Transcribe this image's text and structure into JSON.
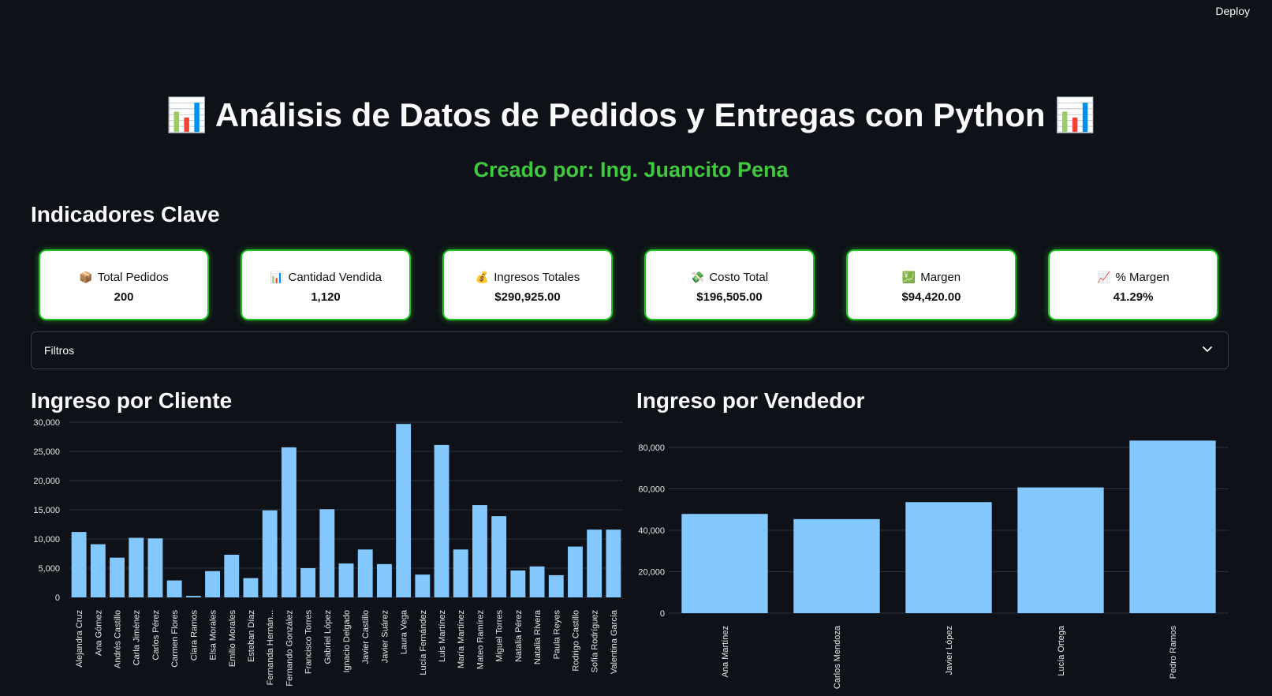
{
  "header": {
    "deploy_label": "Deploy"
  },
  "page": {
    "title": "📊 Análisis de Datos de Pedidos y Entregas con Python 📊",
    "subtitle": "Creado por: Ing. Juancito Pena",
    "kpi_section_title": "Indicadores Clave"
  },
  "kpis": [
    {
      "icon": "📦",
      "icon_name": "package-icon",
      "label": "Total Pedidos",
      "value": "200"
    },
    {
      "icon": "📊",
      "icon_name": "bar-chart-icon",
      "label": "Cantidad Vendida",
      "value": "1,120"
    },
    {
      "icon": "💰",
      "icon_name": "money-bag-icon",
      "label": "Ingresos Totales",
      "value": "$290,925.00"
    },
    {
      "icon": "💸",
      "icon_name": "money-wings-icon",
      "label": "Costo Total",
      "value": "$196,505.00"
    },
    {
      "icon": "💹",
      "icon_name": "chart-yen-icon",
      "label": "Margen",
      "value": "$94,420.00"
    },
    {
      "icon": "📈",
      "icon_name": "trend-up-icon",
      "label": "% Margen",
      "value": "41.29%"
    }
  ],
  "filters": {
    "label": "Filtros",
    "expanded": false
  },
  "colors": {
    "bar": "#83c9ff",
    "accent_green": "#3fc93f",
    "card_border": "#22c322",
    "background": "#0e1117",
    "grid": "#2b2f3a"
  },
  "chart_data": [
    {
      "type": "bar",
      "title": "Ingreso por Cliente",
      "categories": [
        "Alejandra Cruz",
        "Ana Gómez",
        "Andrés Castillo",
        "Carla Jiménez",
        "Carlos Pérez",
        "Carmen Flores",
        "Clara Ramos",
        "Elsa Morales",
        "Emilio Morales",
        "Esteban Díaz",
        "Fernanda Hernán...",
        "Fernando González",
        "Francisco Torres",
        "Gabriel López",
        "Ignacio Delgado",
        "Javier Castillo",
        "Javier Suárez",
        "Laura Vega",
        "Lucía Fernández",
        "Luis Martínez",
        "María Martínez",
        "Mateo Ramírez",
        "Miguel Torres",
        "Natalia Pérez",
        "Natalia Rivera",
        "Paula Reyes",
        "Rodrigo Castillo",
        "Sofía Rodríguez",
        "Valentina García"
      ],
      "values": [
        11200,
        9100,
        6800,
        10200,
        10100,
        2900,
        250,
        4500,
        7300,
        3300,
        14900,
        25700,
        5000,
        15100,
        5800,
        8200,
        5700,
        29700,
        3900,
        26100,
        8200,
        15800,
        13900,
        4600,
        5300,
        3800,
        8700,
        11600,
        11600
      ],
      "ylim": [
        0,
        30000
      ],
      "yticks": [
        0,
        5000,
        10000,
        15000,
        20000,
        25000,
        30000
      ],
      "ytick_labels": [
        "0",
        "5,000",
        "10,000",
        "15,000",
        "20,000",
        "25,000",
        "30,000"
      ],
      "grid": true
    },
    {
      "type": "bar",
      "title": "Ingreso por Vendedor",
      "categories": [
        "Ana Martínez",
        "Carlos Mendoza",
        "Javier López",
        "Lucía Ortega",
        "Pedro Ramos"
      ],
      "values": [
        47900,
        45400,
        53600,
        60700,
        83300
      ],
      "ylim": [
        0,
        88000
      ],
      "yticks": [
        0,
        20000,
        40000,
        60000,
        80000
      ],
      "ytick_labels": [
        "0",
        "20,000",
        "40,000",
        "60,000",
        "80,000"
      ],
      "grid": true
    }
  ]
}
